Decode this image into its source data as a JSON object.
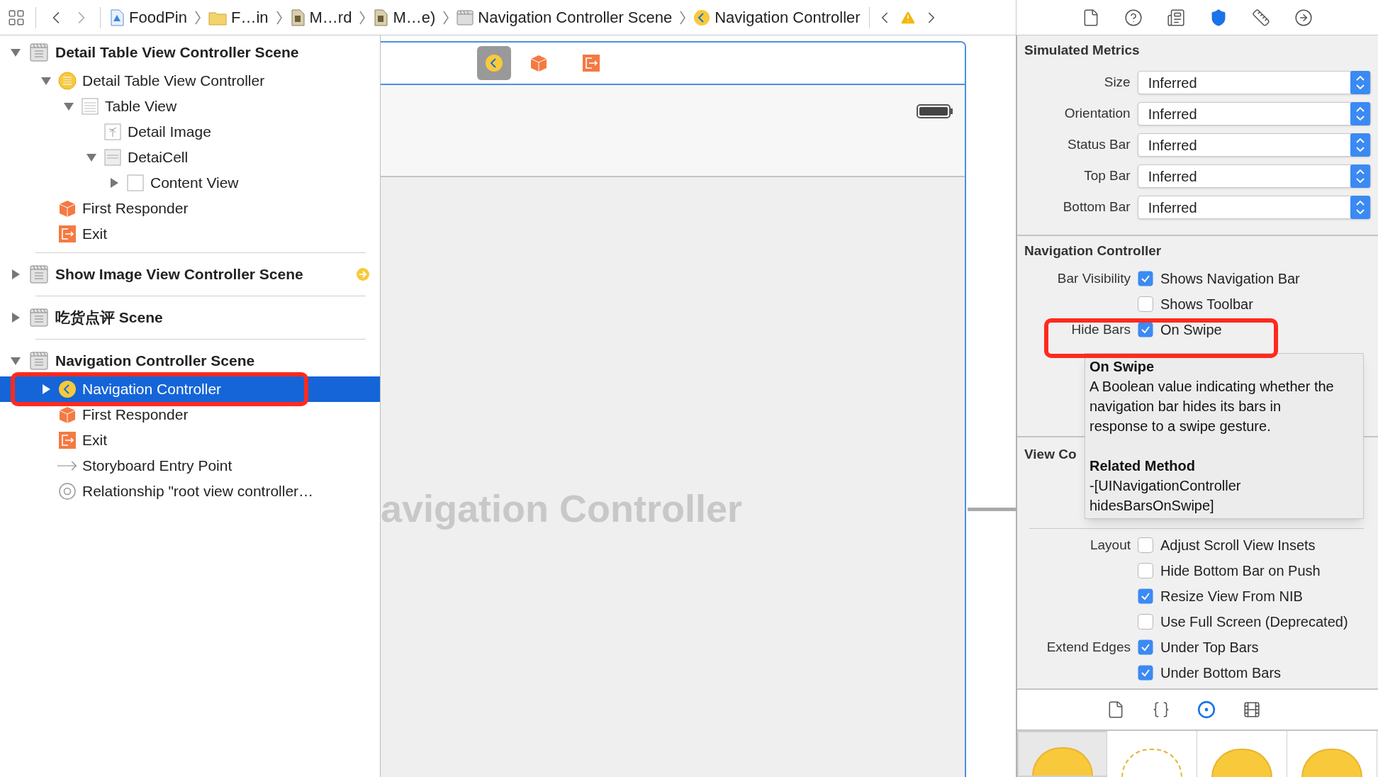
{
  "toolbar": {
    "breadcrumbs": [
      {
        "label": "FoodPin",
        "kind": "project"
      },
      {
        "label": "F…in",
        "kind": "folder"
      },
      {
        "label": "M…rd",
        "kind": "storyboard"
      },
      {
        "label": "M…e)",
        "kind": "storyboard"
      },
      {
        "label": "Navigation Controller Scene",
        "kind": "scene"
      },
      {
        "label": "Navigation Controller",
        "kind": "nav"
      }
    ]
  },
  "inspector_tabs": [
    {
      "selected": false
    },
    {
      "selected": false
    },
    {
      "selected": false
    },
    {
      "selected": true
    },
    {
      "selected": false
    },
    {
      "selected": false
    }
  ],
  "outline": {
    "sections": [
      {
        "title": "Detail Table View Controller Scene",
        "expanded": true,
        "badge": false,
        "children": [
          {
            "label": "Detail Table View Controller",
            "kind": "controller",
            "expanded": true,
            "selected": false,
            "children": [
              {
                "label": "Table View",
                "kind": "table",
                "expanded": true,
                "selected": false,
                "children": [
                  {
                    "label": "Detail Image",
                    "kind": "image",
                    "selected": false
                  },
                  {
                    "label": "DetaiCell",
                    "kind": "cell",
                    "expanded": true,
                    "selected": false,
                    "children": [
                      {
                        "label": "Content View",
                        "kind": "view",
                        "expanded": false,
                        "selected": false
                      }
                    ]
                  }
                ]
              }
            ]
          },
          {
            "label": "First Responder",
            "kind": "responder",
            "selected": false
          },
          {
            "label": "Exit",
            "kind": "exit",
            "selected": false
          }
        ]
      },
      {
        "title": "Show Image View Controller Scene",
        "expanded": false,
        "badge": true
      },
      {
        "title": "吃货点评 Scene",
        "expanded": false,
        "badge": false
      },
      {
        "title": "Navigation Controller Scene",
        "expanded": true,
        "badge": false,
        "children": [
          {
            "label": "Navigation Controller",
            "kind": "nav",
            "expanded": false,
            "selected": true
          },
          {
            "label": "First Responder",
            "kind": "responder",
            "selected": false
          },
          {
            "label": "Exit",
            "kind": "exit",
            "selected": false
          },
          {
            "label": "Storyboard Entry Point",
            "kind": "entry",
            "selected": false
          },
          {
            "label": "Relationship \"root view controller…",
            "kind": "relationship",
            "selected": false
          }
        ]
      }
    ]
  },
  "canvas": {
    "scene_title": "avigation Controller"
  },
  "simulated_metrics": {
    "title": "Simulated Metrics",
    "rows": [
      {
        "label": "Size",
        "value": "Inferred"
      },
      {
        "label": "Orientation",
        "value": "Inferred"
      },
      {
        "label": "Status Bar",
        "value": "Inferred"
      },
      {
        "label": "Top Bar",
        "value": "Inferred"
      },
      {
        "label": "Bottom Bar",
        "value": "Inferred"
      }
    ]
  },
  "navigation_controller": {
    "title": "Navigation Controller",
    "rows": [
      {
        "label": "Bar Visibility",
        "option": "Shows Navigation Bar",
        "checked": true
      },
      {
        "option": "Shows Toolbar",
        "checked": false
      },
      {
        "label": "Hide Bars",
        "option": "On Swipe",
        "checked": true
      }
    ]
  },
  "view_controller": {
    "title": "View Co",
    "rows": [
      {
        "label": "Layout",
        "option": "Adjust Scroll View Insets",
        "checked": false
      },
      {
        "option": "Hide Bottom Bar on Push",
        "checked": false
      },
      {
        "option": "Resize View From NIB",
        "checked": true
      },
      {
        "option": "Use Full Screen (Deprecated)",
        "checked": false
      },
      {
        "label": "Extend Edges",
        "option": "Under Top Bars",
        "checked": true
      },
      {
        "option": "Under Bottom Bars",
        "checked": true
      }
    ]
  },
  "tooltip": {
    "title": "On Swipe",
    "description": "A Boolean value indicating whether the navigation bar hides its bars in response to a swipe gesture.",
    "related_title": "Related Method",
    "method": "-[UINavigationController hidesBarsOnSwipe]"
  },
  "library_tabs": [
    {
      "selected": false
    },
    {
      "selected": false
    },
    {
      "selected": true
    },
    {
      "selected": false
    }
  ],
  "library": [
    {
      "selected": true
    },
    {
      "selected": false
    },
    {
      "selected": false
    },
    {
      "selected": false
    }
  ]
}
